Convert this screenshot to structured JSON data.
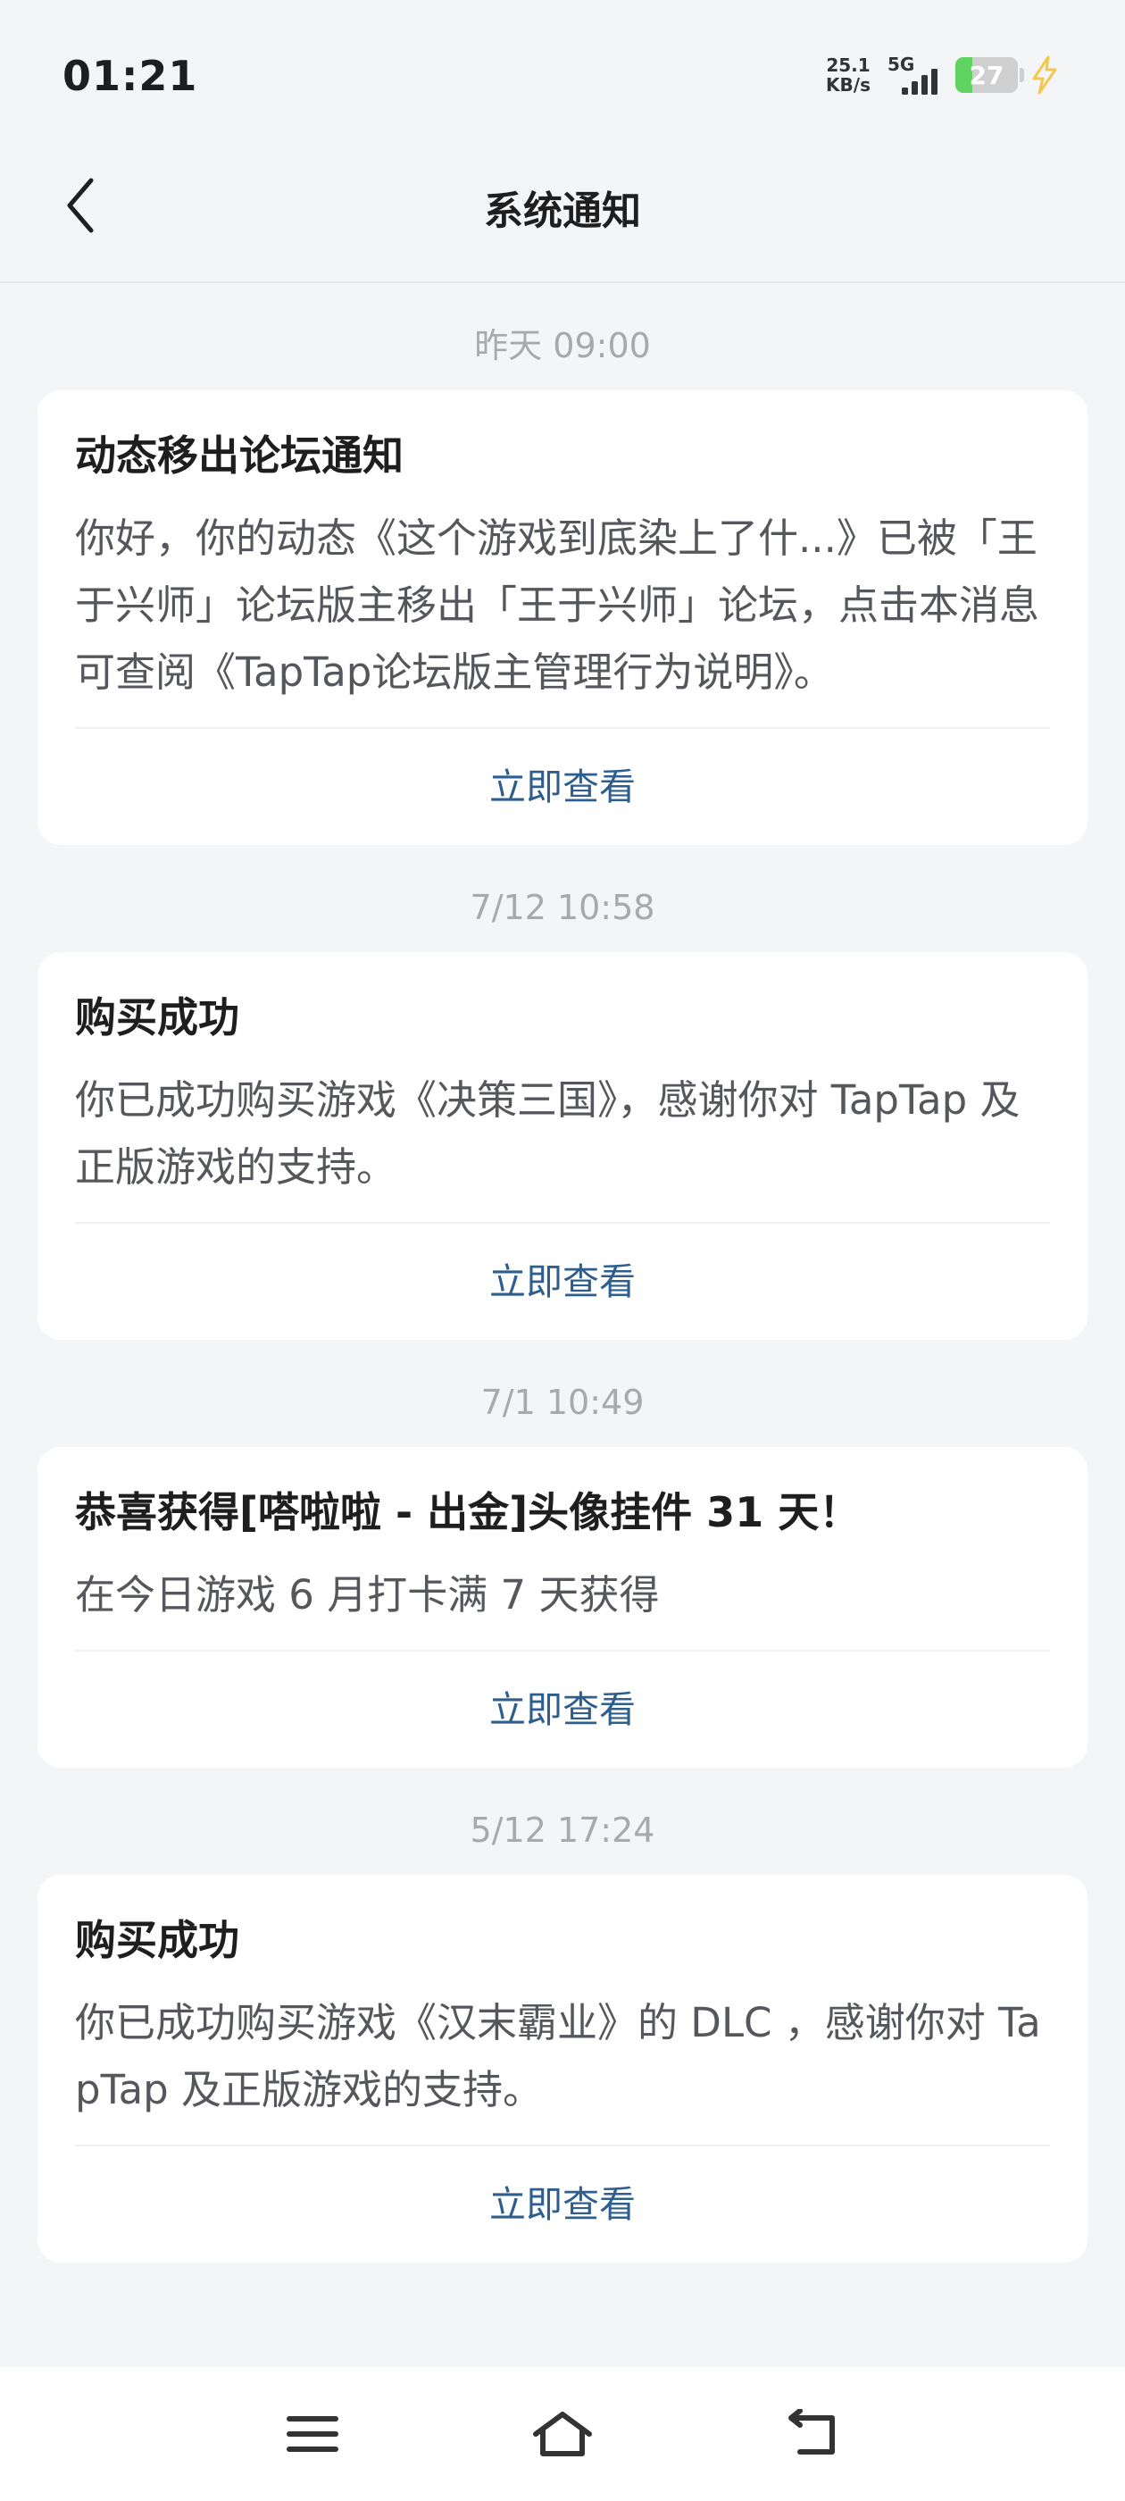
{
  "status_bar": {
    "time": "01:21",
    "net_speed_value": "25.1",
    "net_speed_unit": "KB/s",
    "network_type": "5G",
    "battery_level": "27",
    "battery_fraction": 0.27,
    "icons": [
      "signal-icon",
      "battery-icon",
      "charging-icon"
    ]
  },
  "header": {
    "title": "系统通知",
    "back_icon": "chevron-left-icon"
  },
  "notifications": [
    {
      "time": "昨天  09:00",
      "title": "动态移出论坛通知",
      "body": "你好，你的动态《这个游戏到底染上了什...》已被「王于兴师」论坛版主移出「王于兴师」论坛，点击本消息可查阅《TapTap论坛版主管理行为说明》。",
      "action": "立即查看"
    },
    {
      "time": "7/12  10:58",
      "title": "购买成功",
      "body": "你已成功购买游戏《决策三国》，感谢你对 TapTap 及正版游戏的支持。",
      "action": "立即查看"
    },
    {
      "time": "7/1  10:49",
      "title": "恭喜获得[嗒啦啦 - 出金]头像挂件 31 天！",
      "body": "在今日游戏 6 月打卡满 7 天获得",
      "action": "立即查看"
    },
    {
      "time": "5/12  17:24",
      "title": "购买成功",
      "body": "你已成功购买游戏《汉末霸业》的 DLC ，感谢你对 TapTap 及正版游戏的支持。",
      "action": "立即查看"
    }
  ],
  "nav_bar": {
    "icons": [
      "menu-icon",
      "home-icon",
      "back-icon"
    ]
  },
  "colors": {
    "background": "#f4f5f7",
    "card": "#ffffff",
    "title_text": "#1e1e1e",
    "body_text": "#55575c",
    "timestamp_text": "#a8a9ad",
    "action_link": "#2d5e8e",
    "battery_green": "#5fd35f",
    "charging_yellow": "#f2c94c"
  }
}
